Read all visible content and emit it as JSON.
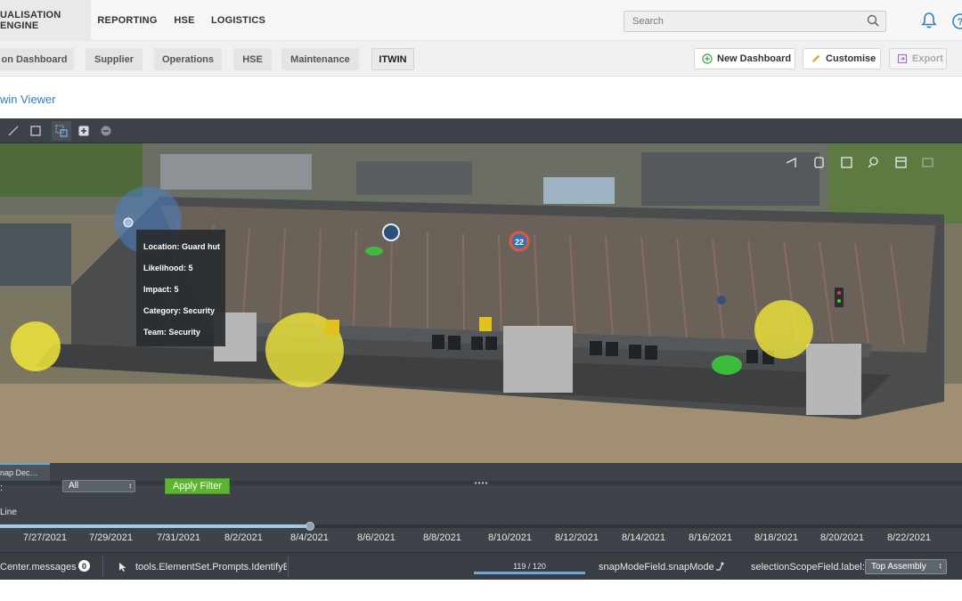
{
  "topnav": {
    "app_title": "UALISATION ENGINE",
    "items": [
      "REPORTING",
      "HSE",
      "LOGISTICS"
    ]
  },
  "search": {
    "placeholder": "Search"
  },
  "tabs": [
    {
      "label": "on Dashboard"
    },
    {
      "label": "Supplier"
    },
    {
      "label": "Operations"
    },
    {
      "label": "HSE"
    },
    {
      "label": "Maintenance"
    },
    {
      "label": "ITWIN",
      "active": true
    }
  ],
  "actions": {
    "new_dashboard": "New Dashboard",
    "customise": "Customise",
    "export": "Export"
  },
  "page": {
    "title": "win Viewer"
  },
  "tooltip": {
    "location": "Location: Guard hut",
    "likelihood": "Likelihood: 5",
    "impact": "Impact: 5",
    "category": "Category: Security",
    "team": "Team: Security"
  },
  "viewer": {
    "marker_count": "22"
  },
  "lower_panel": {
    "tab_label": "nap Dec…",
    "filter_label": ":",
    "filter_value": "All",
    "apply_label": "Apply Filter",
    "line_label": "Line",
    "timeline_progress": 0.32,
    "dates": [
      "7/27/2021",
      "7/29/2021",
      "7/31/2021",
      "8/2/2021",
      "8/4/2021",
      "8/6/2021",
      "8/8/2021",
      "8/10/2021",
      "8/12/2021",
      "8/14/2021",
      "8/16/2021",
      "8/18/2021",
      "8/20/2021",
      "8/22/2021"
    ]
  },
  "statusbar": {
    "messages": "Center.messages",
    "messages_count": "0",
    "prompt": "tools.ElementSet.Prompts.IdentifyE",
    "progress_text": "119 / 120",
    "snap_mode": "snapModeField.snapMode",
    "scope_label": "selectionScopeField.label:",
    "scope_value": "Top Assembly"
  },
  "colors": {
    "accent": "#2f7fb8",
    "apply_green": "#5cb531",
    "hazard_yellow": "#f0e63a",
    "safe_green": "#39d13a"
  }
}
